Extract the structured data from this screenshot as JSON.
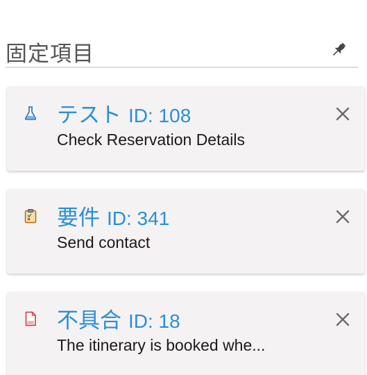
{
  "panel": {
    "title": "固定項目",
    "pin_icon": "pin-icon"
  },
  "items": [
    {
      "type_label": "テスト",
      "id_text": "ID: 108",
      "description": "Check Reservation Details",
      "icon": "flask-icon",
      "icon_color": "#2a6fb8"
    },
    {
      "type_label": "要件",
      "id_text": "ID: 341",
      "description": "Send contact",
      "icon": "clipboard-icon",
      "icon_color": "#c98a2a"
    },
    {
      "type_label": "不具合",
      "id_text": "ID: 18",
      "description": "The itinerary is booked whe...",
      "icon": "document-bug-icon",
      "icon_color": "#c8323a"
    }
  ],
  "colors": {
    "link": "#2a8fd6",
    "card_bg": "#f5f2f4",
    "close": "#6a6a6a"
  }
}
